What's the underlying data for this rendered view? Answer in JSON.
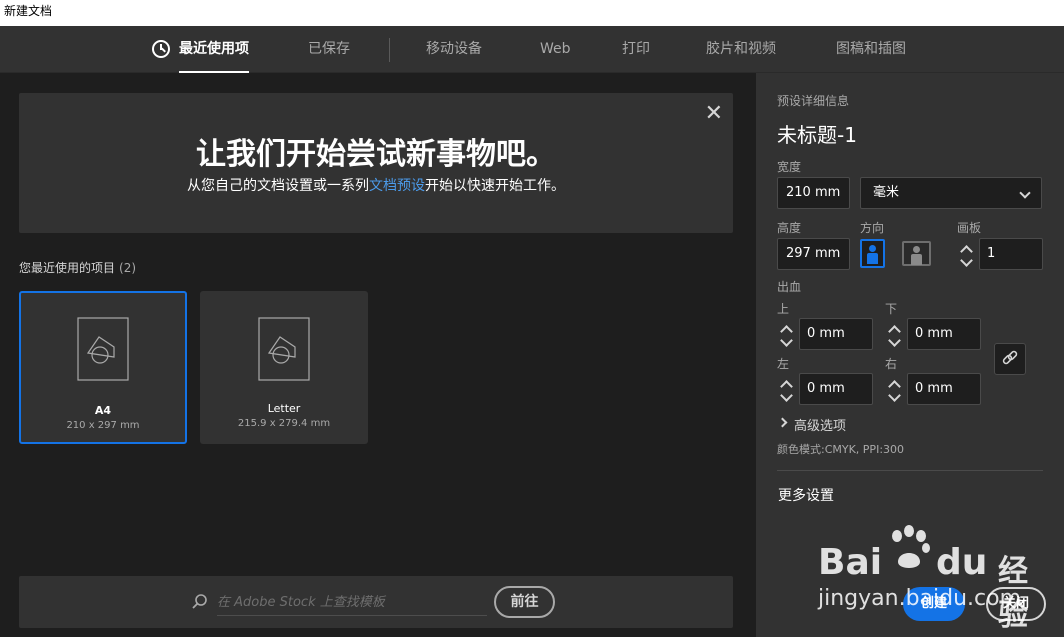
{
  "window": {
    "title": "新建文档"
  },
  "tabs": [
    {
      "label": "最近使用项",
      "active": true
    },
    {
      "label": "已保存"
    },
    {
      "label": "移动设备"
    },
    {
      "label": "Web"
    },
    {
      "label": "打印"
    },
    {
      "label": "胶片和视频"
    },
    {
      "label": "图稿和插图"
    }
  ],
  "banner": {
    "title": "让我们开始尝试新事物吧。",
    "sub_before": "从您自己的文档设置或一系列",
    "sub_link": "文档预设",
    "sub_after": "开始以快速开始工作。"
  },
  "recent": {
    "label": "您最近使用的项目",
    "count": "(2)",
    "items": [
      {
        "name": "A4",
        "size": "210 x 297 mm",
        "selected": true
      },
      {
        "name": "Letter",
        "size": "215.9 x 279.4 mm"
      }
    ]
  },
  "stock": {
    "placeholder": "在 Adobe Stock 上查找模板",
    "go_label": "前往"
  },
  "details": {
    "header": "预设详细信息",
    "doc_name": "未标题-1",
    "width_label": "宽度",
    "width_value": "210 mm",
    "unit_value": "毫米",
    "height_label": "高度",
    "height_value": "297 mm",
    "orientation_label": "方向",
    "artboards_label": "画板",
    "artboards_value": "1",
    "bleed_label": "出血",
    "top_label": "上",
    "top_value": "0 mm",
    "bottom_label": "下",
    "bottom_value": "0 mm",
    "left_label": "左",
    "left_value": "0 mm",
    "right_label": "右",
    "right_value": "0 mm",
    "advanced_label": "高级选项",
    "color_mode": "颜色模式:CMYK, PPI:300",
    "more_settings": "更多设置",
    "create_label": "创建",
    "close_label": "关闭"
  },
  "watermark": {
    "brand_left": "Bai",
    "brand_right": "du",
    "brand_cn": "经验",
    "url": "jingyan.baidu.com"
  },
  "colors": {
    "accent": "#1473e6",
    "link": "#4c9bea",
    "panel": "#323232",
    "background": "#1e1e1e"
  }
}
